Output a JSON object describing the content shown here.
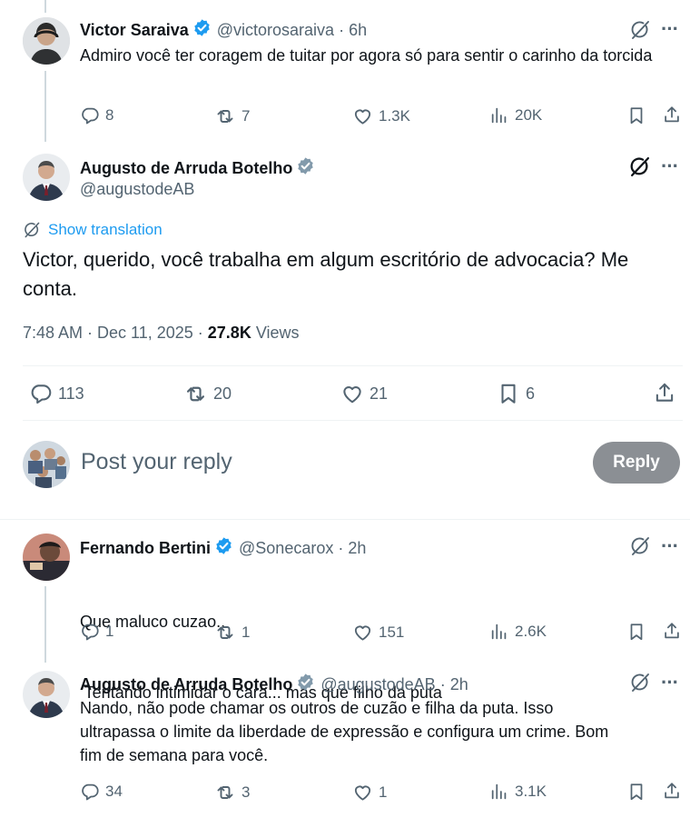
{
  "tweet1": {
    "name": "Victor Saraiva",
    "handle": "@victorosaraiva",
    "time": "· 6h",
    "text": "Admiro você ter coragem de tuitar por agora só para sentir o carinho da torcida",
    "replies": "8",
    "retweets": "7",
    "likes": "1.3K",
    "views": "20K"
  },
  "main": {
    "name": "Augusto de Arruda Botelho",
    "handle": "@augustodeAB",
    "show_translation": "Show translation",
    "text": "Victor, querido, você trabalha em algum escritório de advocacia? Me conta.",
    "timestamp": "7:48 AM · Dec 11, 2025 · ",
    "views_count": "27.8K",
    "views_label": " Views",
    "replies": "113",
    "retweets": "20",
    "likes": "21",
    "bookmarks": "6"
  },
  "composer": {
    "placeholder": "Post your reply",
    "button": "Reply"
  },
  "reply1": {
    "name": "Fernando Bertini",
    "handle": "@Sonecarox",
    "time": "· 2h",
    "line1": "Que maluco cuzao..",
    "line2": " Tentando intimidar o cara... mas que filho da puta",
    "replies": "1",
    "retweets": "1",
    "likes": "151",
    "views": "2.6K"
  },
  "reply2": {
    "name": "Augusto de Arruda Botelho",
    "handle": "@augustodeAB",
    "time": "· 2h",
    "text": "Nando, não pode chamar os outros de cuzão e filha da puta. Isso ultrapassa o limite da liberdade de expressão e configura um crime. Bom fim de semana para você.",
    "replies": "34",
    "retweets": "3",
    "likes": "1",
    "views": "3.1K"
  },
  "colors": {
    "verified_blue": "#1d9bf0",
    "verified_gray": "#829aab",
    "reply_button": "#8b8f94",
    "link": "#1d9bf0"
  }
}
